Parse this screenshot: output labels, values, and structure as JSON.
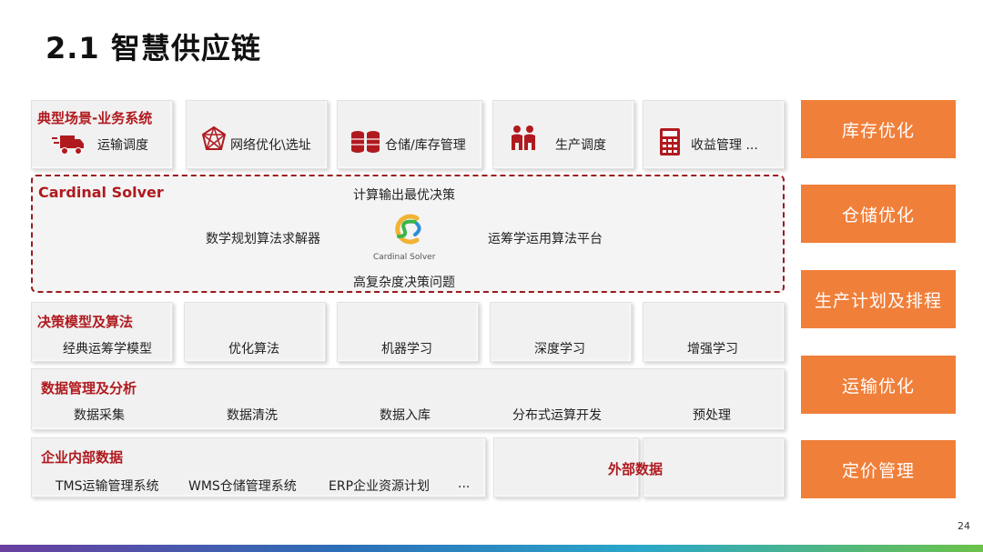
{
  "title": "2.1 智慧供应链",
  "page_number": "24",
  "scenario": {
    "header": "典型场景-业务系统",
    "items": [
      {
        "label": "运输调度",
        "icon": "truck-icon"
      },
      {
        "label": "网络优化\\选址",
        "icon": "network-icon"
      },
      {
        "label": "仓储/库存管理",
        "icon": "database-icon"
      },
      {
        "label": "生产调度",
        "icon": "workers-icon"
      },
      {
        "label": "收益管理 ...",
        "icon": "calculator-icon"
      }
    ]
  },
  "solver": {
    "header": "Cardinal Solver",
    "top": "计算输出最优决策",
    "left": "数学规划算法求解器",
    "right": "运筹学运用算法平台",
    "bottom": "高复杂度决策问题",
    "logo_text": "Cardinal Solver"
  },
  "models": {
    "header": "决策模型及算法",
    "items": [
      "经典运筹学模型",
      "优化算法",
      "机器学习",
      "深度学习",
      "增强学习"
    ]
  },
  "data_mgmt": {
    "header": "数据管理及分析",
    "items": [
      "数据采集",
      "数据清洗",
      "数据入库",
      "分布式运算开发",
      "预处理"
    ]
  },
  "internal": {
    "header": "企业内部数据",
    "items": [
      "TMS运输管理系统",
      "WMS仓储管理系统",
      "ERP企业资源计划",
      "..."
    ]
  },
  "external": {
    "label": "外部数据"
  },
  "right_buttons": [
    "库存优化",
    "仓储优化",
    "生产计划及排程",
    "运输优化",
    "定价管理"
  ],
  "colors": {
    "accent_red": "#b01a1f",
    "orange": "#f07f3a"
  }
}
